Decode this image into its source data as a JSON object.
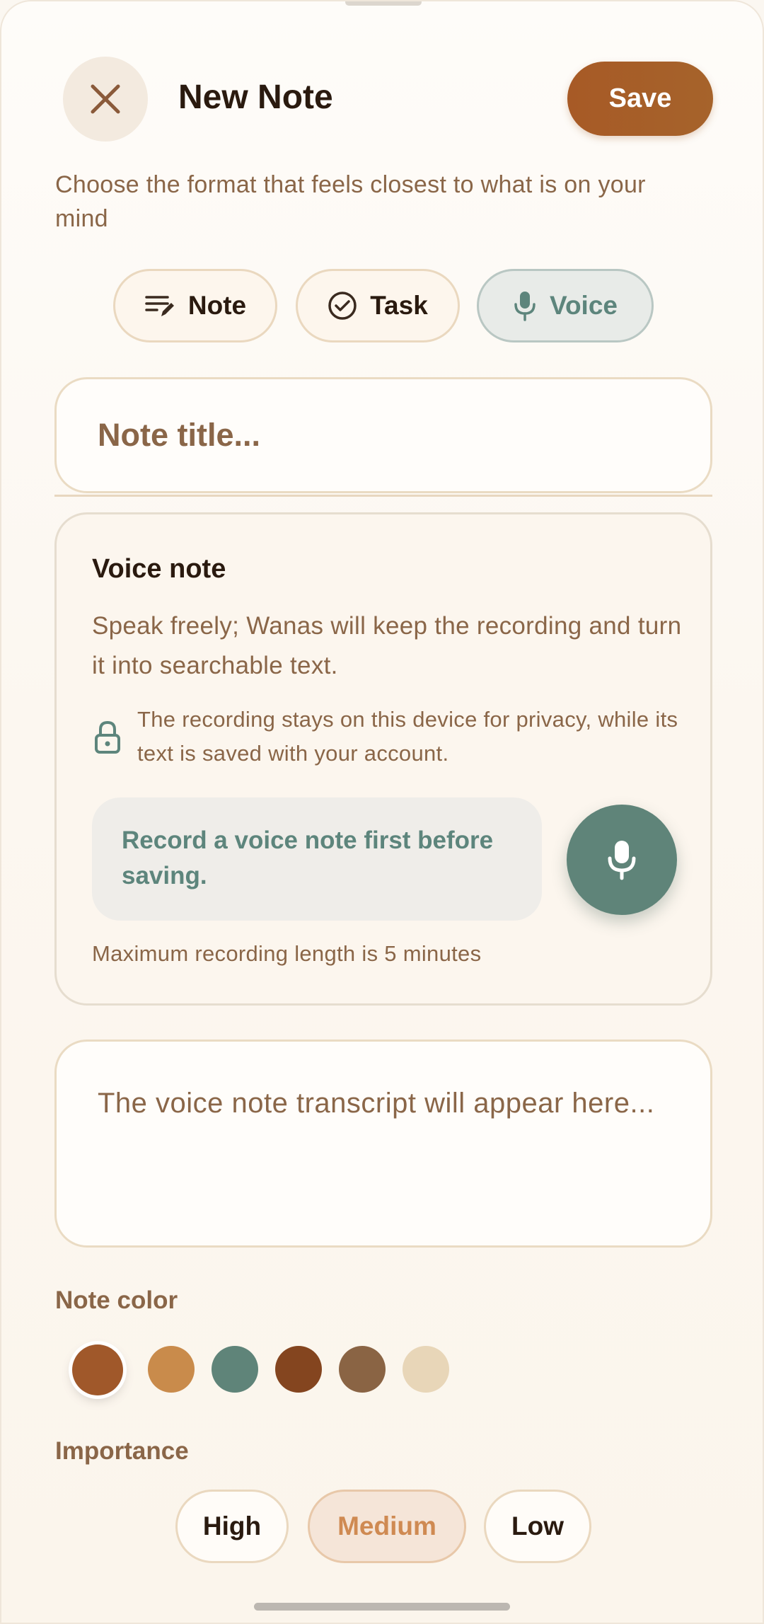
{
  "header": {
    "title": "New Note",
    "save_label": "Save",
    "close_icon": "close-icon"
  },
  "subtitle": "Choose the format that feels closest to what is on your mind",
  "note_types": [
    {
      "label": "Note",
      "icon": "note-lines-icon",
      "selected": false
    },
    {
      "label": "Task",
      "icon": "check-circle-icon",
      "selected": false
    },
    {
      "label": "Voice",
      "icon": "microphone-icon",
      "selected": true
    }
  ],
  "title_input": {
    "placeholder": "Note title..."
  },
  "voice_card": {
    "title": "Voice note",
    "description": "Speak freely; Wanas will keep the recording and turn it into searchable text.",
    "privacy_icon": "lock-icon",
    "privacy_text": "The recording stays on this device for privacy, while its text is saved with your account.",
    "record_hint": "Record a voice note first before saving.",
    "mic_button_icon": "microphone-icon",
    "limit_text": "Maximum recording length is 5 minutes"
  },
  "transcript": {
    "placeholder": "The voice note transcript will appear here..."
  },
  "note_color": {
    "label": "Note color",
    "swatches": [
      "#a0582a",
      "#c98b4b",
      "#5f8479",
      "#84451f",
      "#8a6444",
      "#e8d6b8"
    ],
    "selected_index": 0
  },
  "importance": {
    "label": "Importance",
    "options": [
      "High",
      "Medium",
      "Low"
    ],
    "selected": "Medium"
  },
  "colors": {
    "accent": "#a75a26",
    "voice": "#5f8479",
    "text_muted": "#8a6648"
  }
}
